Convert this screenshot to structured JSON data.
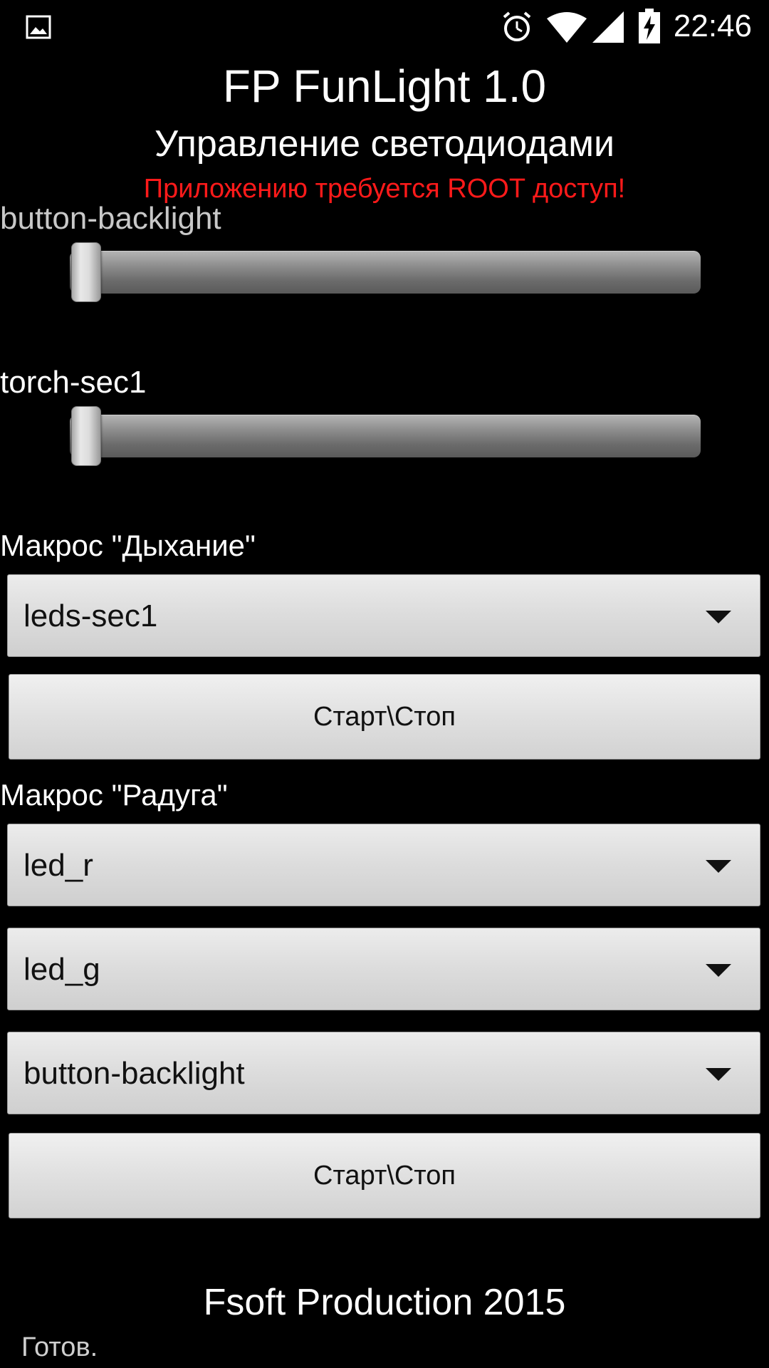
{
  "status_bar": {
    "time": "22:46",
    "icons": [
      "image-notification-icon",
      "alarm-icon",
      "wifi-icon",
      "signal-icon",
      "battery-charging-icon"
    ]
  },
  "header": {
    "title": "FP FunLight 1.0",
    "subtitle": "Управление светодиодами",
    "warning": "Приложению требуется ROOT доступ!",
    "warning_color": "#ff1a1a"
  },
  "sliders": [
    {
      "label": "button-backlight",
      "value": 0.0
    },
    {
      "label": "torch-sec1",
      "value": 0.0
    }
  ],
  "macro_breath": {
    "label": "Макрос \"Дыхание\"",
    "spinner_value": "leds-sec1",
    "button_label": "Старт\\Стоп"
  },
  "macro_rainbow": {
    "label": "Макрос \"Радуга\"",
    "spinner_values": [
      "led_r",
      "led_g",
      "button-backlight"
    ],
    "button_label": "Старт\\Стоп"
  },
  "footer": {
    "credits": "Fsoft Production 2015",
    "status": "Готов."
  }
}
